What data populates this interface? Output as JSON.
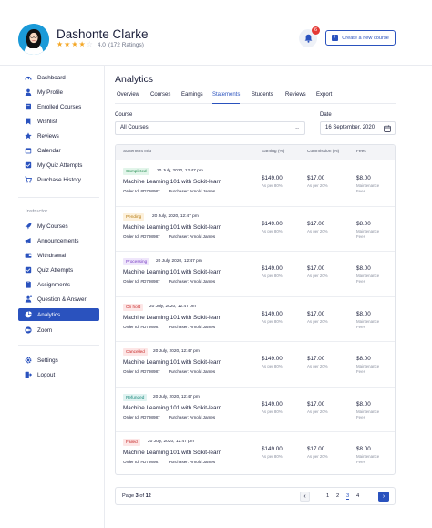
{
  "header": {
    "user_name": "Dashonte Clarke",
    "rating_value": "4.0",
    "rating_count": "(172 Ratings)",
    "rating_stars": 4,
    "notification_count": "6",
    "create_button": "Create a new course"
  },
  "sidebar": {
    "items": [
      {
        "label": "Dashboard",
        "icon": "dashboard-icon"
      },
      {
        "label": "My Profile",
        "icon": "user-icon"
      },
      {
        "label": "Enrolled Courses",
        "icon": "book-icon"
      },
      {
        "label": "Wishlist",
        "icon": "bookmark-icon"
      },
      {
        "label": "Reviews",
        "icon": "star-icon"
      },
      {
        "label": "Calendar",
        "icon": "calendar-icon"
      },
      {
        "label": "My Quiz Attempts",
        "icon": "quiz-icon"
      },
      {
        "label": "Purchase History",
        "icon": "cart-icon"
      }
    ],
    "instructor_label": "Instructor",
    "instructor_items": [
      {
        "label": "My Courses",
        "icon": "rocket-icon"
      },
      {
        "label": "Announcements",
        "icon": "megaphone-icon"
      },
      {
        "label": "Withdrawal",
        "icon": "wallet-icon"
      },
      {
        "label": "Quiz Attempts",
        "icon": "quiz-icon"
      },
      {
        "label": "Assignments",
        "icon": "clipboard-icon"
      },
      {
        "label": "Question & Answer",
        "icon": "qa-icon"
      },
      {
        "label": "Analytics",
        "icon": "pie-chart-icon"
      },
      {
        "label": "Zoom",
        "icon": "zoom-icon"
      }
    ],
    "footer_items": [
      {
        "label": "Settings",
        "icon": "gear-icon"
      },
      {
        "label": "Logout",
        "icon": "logout-icon"
      }
    ],
    "active": "Analytics"
  },
  "main": {
    "title": "Analytics",
    "tabs": [
      "Overview",
      "Courses",
      "Earnings",
      "Statements",
      "Students",
      "Reviews",
      "Export"
    ],
    "active_tab": "Statements",
    "course_label": "Course",
    "course_value": "All Courses",
    "date_label": "Date",
    "date_value": "16  September, 2020"
  },
  "table": {
    "headers": {
      "info": "Statement Info",
      "earning": "Earning (%)",
      "commission": "Commission (%)",
      "fees": "Fees"
    },
    "rows": [
      {
        "status": "Completed",
        "datetime": "20 July, 2020, 12:47 pm",
        "course": "Machine Learning 101 with Scikit-learn",
        "order": "Order Id: #D798987",
        "purchaser": "Purchaser: Arnold James",
        "earning": "$149.00",
        "earning_note": "As per 80%",
        "commission": "$17.00",
        "commission_note": "As per 20%",
        "fees": "$8.00",
        "fees_note": "Maintenance Fees"
      },
      {
        "status": "Pending",
        "datetime": "20 July, 2020, 12:47 pm",
        "course": "Machine Learning 101 with Scikit-learn",
        "order": "Order Id: #D798987",
        "purchaser": "Purchaser: Arnold James",
        "earning": "$149.00",
        "earning_note": "As per 80%",
        "commission": "$17.00",
        "commission_note": "As per 20%",
        "fees": "$8.00",
        "fees_note": "Maintenance Fees"
      },
      {
        "status": "Processing",
        "datetime": "20 July, 2020, 12:47 pm",
        "course": "Machine Learning 101 with Scikit-learn",
        "order": "Order Id: #D798987",
        "purchaser": "Purchaser: Arnold James",
        "earning": "$149.00",
        "earning_note": "As per 80%",
        "commission": "$17.00",
        "commission_note": "As per 20%",
        "fees": "$8.00",
        "fees_note": "Maintenance Fees"
      },
      {
        "status": "On hold",
        "datetime": "20 July, 2020, 12:47 pm",
        "course": "Machine Learning 101 with Scikit-learn",
        "order": "Order Id: #D798987",
        "purchaser": "Purchaser: Arnold James",
        "earning": "$149.00",
        "earning_note": "As per 80%",
        "commission": "$17.00",
        "commission_note": "As per 20%",
        "fees": "$8.00",
        "fees_note": "Maintenance Fees"
      },
      {
        "status": "Cancelled",
        "datetime": "20 July, 2020, 12:47 pm",
        "course": "Machine Learning 101 with Scikit-learn",
        "order": "Order Id: #D798987",
        "purchaser": "Purchaser: Arnold James",
        "earning": "$149.00",
        "earning_note": "As per 80%",
        "commission": "$17.00",
        "commission_note": "As per 20%",
        "fees": "$8.00",
        "fees_note": "Maintenance Fees"
      },
      {
        "status": "Refunded",
        "datetime": "20 July, 2020, 12:47 pm",
        "course": "Machine Learning 101 with Scikit-learn",
        "order": "Order Id: #D798987",
        "purchaser": "Purchaser: Arnold James",
        "earning": "$149.00",
        "earning_note": "As per 80%",
        "commission": "$17.00",
        "commission_note": "As per 20%",
        "fees": "$8.00",
        "fees_note": "Maintenance Fees"
      },
      {
        "status": "Failed",
        "datetime": "20 July, 2020, 12:47 pm",
        "course": "Machine Learning 101 with Scikit-learn",
        "order": "Order Id: #D798987",
        "purchaser": "Purchaser: Arnold James",
        "earning": "$149.00",
        "earning_note": "As per 80%",
        "commission": "$17.00",
        "commission_note": "As per 20%",
        "fees": "$8.00",
        "fees_note": "Maintenance Fees"
      }
    ],
    "status_colors": {
      "Completed": {
        "bg": "#e2f5ea",
        "fg": "#1e8a4c"
      },
      "Pending": {
        "bg": "#fdf1dc",
        "fg": "#b57a10"
      },
      "Processing": {
        "bg": "#efe6fb",
        "fg": "#7a3fc4"
      },
      "On hold": {
        "bg": "#fde6e6",
        "fg": "#c62828"
      },
      "Cancelled": {
        "bg": "#fde6e6",
        "fg": "#c62828"
      },
      "Refunded": {
        "bg": "#e0f3f1",
        "fg": "#17877a"
      },
      "Failed": {
        "bg": "#fde6e6",
        "fg": "#c62828"
      }
    }
  },
  "pagination": {
    "page_word": "Page",
    "current": "3",
    "of_word": "of",
    "total": "12",
    "pages": [
      "1",
      "2",
      "3",
      "4"
    ],
    "active_page": "3"
  },
  "colors": {
    "accent": "#2a52be",
    "text": "#1b1f3b",
    "muted": "#8a90a0",
    "border": "#e1e4ea"
  }
}
